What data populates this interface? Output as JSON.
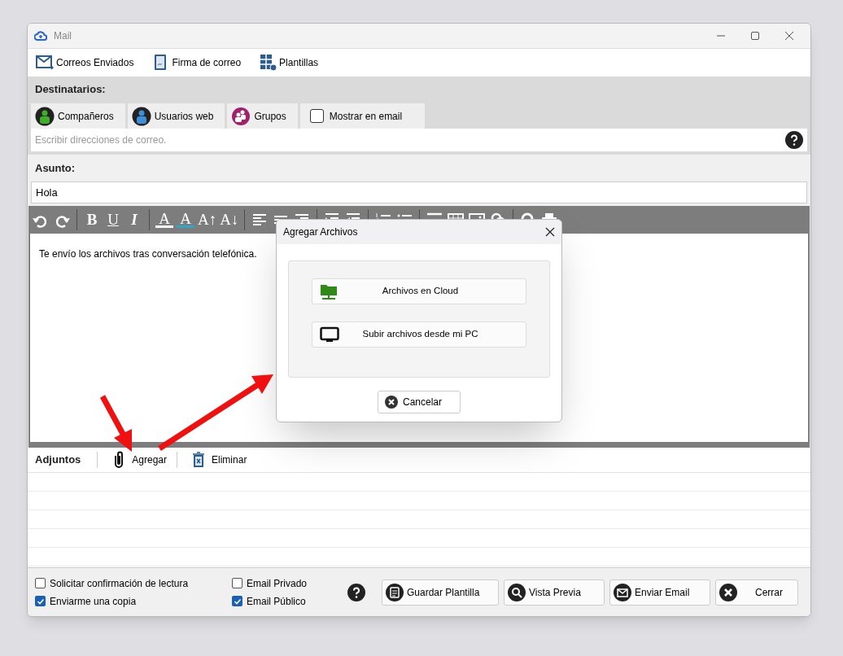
{
  "window": {
    "title": "Mail"
  },
  "toolbar": [
    {
      "kind": "sent",
      "label": "Correos Enviados"
    },
    {
      "kind": "signature",
      "label": "Firma de correo"
    },
    {
      "kind": "templates",
      "label": "Plantillas"
    }
  ],
  "recipients": {
    "label": "Destinatarios:",
    "sources": [
      {
        "kind": "person",
        "label": "Compañeros",
        "color": "#3fae29"
      },
      {
        "kind": "person",
        "label": "Usuarios web",
        "color": "#3d8fd6"
      },
      {
        "kind": "group",
        "label": "Grupos",
        "color": "#a1226b"
      }
    ],
    "show_in_email": {
      "label": "Mostrar en email",
      "checked": false
    },
    "placeholder": "Escribir direcciones de correo."
  },
  "subject": {
    "label": "Asunto:",
    "value": "Hola"
  },
  "editor": {
    "tools": [
      {
        "kind": "undo"
      },
      {
        "kind": "redo"
      },
      {
        "kind": "sep"
      },
      {
        "kind": "bold",
        "glyph": "B"
      },
      {
        "kind": "underline",
        "glyph": "U"
      },
      {
        "kind": "italic",
        "glyph": "I"
      },
      {
        "kind": "sep"
      },
      {
        "kind": "textcolor",
        "glyph": "A"
      },
      {
        "kind": "highlight",
        "glyph": "A"
      },
      {
        "kind": "grow",
        "glyph": "A↑"
      },
      {
        "kind": "shrink",
        "glyph": "A↓"
      },
      {
        "kind": "sep"
      },
      {
        "kind": "alignleft"
      },
      {
        "kind": "justify"
      },
      {
        "kind": "alignright"
      },
      {
        "kind": "sep"
      },
      {
        "kind": "indent"
      },
      {
        "kind": "outdent"
      },
      {
        "kind": "sep"
      },
      {
        "kind": "numbered"
      },
      {
        "kind": "bullets"
      },
      {
        "kind": "sep"
      },
      {
        "kind": "rule"
      },
      {
        "kind": "table"
      },
      {
        "kind": "image"
      },
      {
        "kind": "link"
      },
      {
        "kind": "sep"
      },
      {
        "kind": "search"
      },
      {
        "kind": "print"
      }
    ],
    "body": "Te envío los archivos tras conversación telefónica."
  },
  "attachments": {
    "label": "Adjuntos",
    "actions": [
      {
        "kind": "add",
        "label": "Agregar"
      },
      {
        "kind": "delete",
        "label": "Eliminar"
      }
    ]
  },
  "options": [
    {
      "label": "Solicitar confirmación de lectura",
      "checked": false
    },
    {
      "label": "Enviarme una copia",
      "checked": true
    },
    {
      "label": "Email Privado",
      "checked": false
    },
    {
      "label": "Email Público",
      "checked": true
    }
  ],
  "buttons": [
    {
      "kind": "save",
      "label": "Guardar Plantilla"
    },
    {
      "kind": "preview",
      "label": "Vista Previa"
    },
    {
      "kind": "send",
      "label": "Enviar Email"
    },
    {
      "kind": "close",
      "label": "Cerrar"
    }
  ],
  "dialog": {
    "title": "Agregar Archivos",
    "options": [
      {
        "kind": "cloud",
        "label": "Archivos en Cloud"
      },
      {
        "kind": "pc",
        "label": "Subir archivos desde mi PC"
      }
    ],
    "cancel": "Cancelar"
  }
}
